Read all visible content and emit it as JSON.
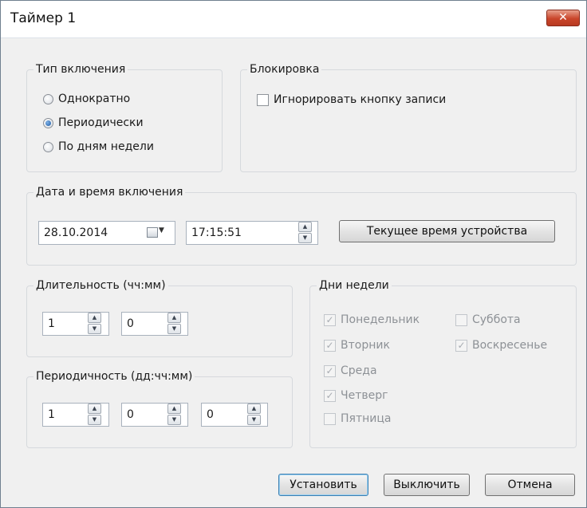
{
  "window": {
    "title": "Таймер 1",
    "close_glyph": "✕"
  },
  "activation_type": {
    "legend": "Тип включения",
    "options": [
      {
        "label": "Однократно",
        "selected": false
      },
      {
        "label": "Периодически",
        "selected": true
      },
      {
        "label": "По дням недели",
        "selected": false
      }
    ]
  },
  "lock": {
    "legend": "Блокировка",
    "ignore_record_label": "Игнорировать кнопку записи",
    "ignore_record_checked": false
  },
  "datetime": {
    "legend": "Дата и время включения",
    "date": "28.10.2014",
    "time": "17:15:51",
    "device_time_button": "Текущее время устройства"
  },
  "duration": {
    "legend": "Длительность (чч:мм)",
    "hours": "1",
    "minutes": "0"
  },
  "periodicity": {
    "legend": "Периодичность (дд:чч:мм)",
    "days": "1",
    "hours": "0",
    "minutes": "0"
  },
  "weekdays": {
    "legend": "Дни недели",
    "days": [
      {
        "label": "Понедельник",
        "checked": true
      },
      {
        "label": "Вторник",
        "checked": true
      },
      {
        "label": "Среда",
        "checked": true
      },
      {
        "label": "Четверг",
        "checked": true
      },
      {
        "label": "Пятница",
        "checked": false
      },
      {
        "label": "Суббота",
        "checked": false
      },
      {
        "label": "Воскресенье",
        "checked": true
      }
    ],
    "check_glyph": "✓"
  },
  "buttons": {
    "set": "Установить",
    "disable": "Выключить",
    "cancel": "Отмена"
  },
  "spin_glyphs": {
    "up": "▲",
    "down": "▼"
  },
  "colors": {
    "close_red": "#c9452a",
    "default_border": "#3c7fb1"
  }
}
